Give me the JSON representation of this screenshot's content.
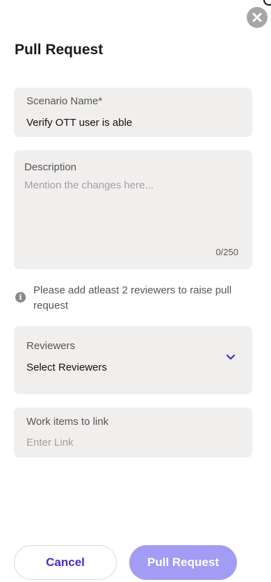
{
  "header": {
    "title": "Pull Request"
  },
  "form": {
    "scenario": {
      "label": "Scenario Name*",
      "value": "Verify OTT user is able"
    },
    "description": {
      "label": "Description",
      "placeholder": "Mention the changes here...",
      "counter": "0/250"
    },
    "info": {
      "text": "Please add atleast 2 reviewers to raise pull request"
    },
    "reviewers": {
      "label": "Reviewers",
      "value": "Select Reviewers"
    },
    "work_items": {
      "label": "Work items to link",
      "placeholder": "Enter Link"
    }
  },
  "footer": {
    "cancel_label": "Cancel",
    "submit_label": "Pull Request"
  },
  "colors": {
    "accent": "#3f2fc6",
    "submit_bg": "#a29cf4",
    "field_bg": "#f1efee"
  },
  "icons": {
    "close": "close-icon",
    "info": "info-icon",
    "dropdown": "chevron-down-icon"
  }
}
